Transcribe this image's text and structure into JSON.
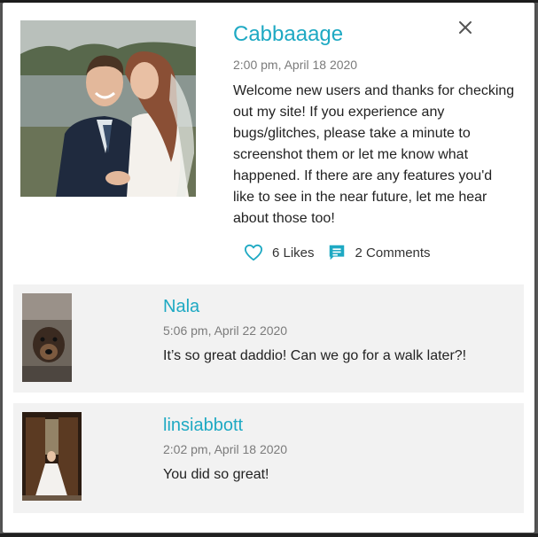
{
  "post": {
    "title": "Cabbaaage",
    "date": "2:00 pm, April 18 2020",
    "body": "Welcome new users and thanks for checking out my site! If you experience any bugs/glitches, please take a minute to screenshot them or let me know what happened. If there are any features you'd like to see in the near future, let me hear about those too!",
    "likes_label": "6 Likes",
    "comments_label": "2 Comments"
  },
  "icons": {
    "close": "close-icon",
    "like": "heart-icon",
    "comments": "comment-icon"
  },
  "colors": {
    "accent": "#1ea9c3",
    "comment_background": "#f2f2f2"
  },
  "comments": [
    {
      "name": "Nala",
      "date": "5:06 pm, April 22 2020",
      "text": "It’s so great daddio! Can we go for a walk later?!"
    },
    {
      "name": "linsiabbott",
      "date": "2:02 pm, April 18 2020",
      "text": "You did so great!"
    }
  ]
}
